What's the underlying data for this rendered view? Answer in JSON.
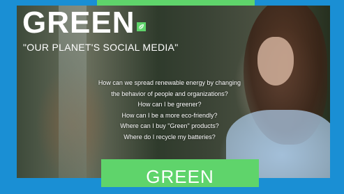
{
  "brand": {
    "logo_text": "GREEN",
    "tagline": "\"OUR PLANET'S SOCIAL MEDIA\""
  },
  "questions": [
    "How can we spread renewable energy by changing",
    "the behavior of people and organizations?",
    "How can I be greener?",
    "How can I be a more eco-friendly?",
    "Where can I buy \"Green\" products?",
    "Where do I recycle my batteries?"
  ],
  "cta": {
    "label": "GREEN"
  },
  "colors": {
    "background": "#1a8fd4",
    "accent": "#5fd46b"
  },
  "icons": {
    "logo_mark": "leaf-icon"
  }
}
